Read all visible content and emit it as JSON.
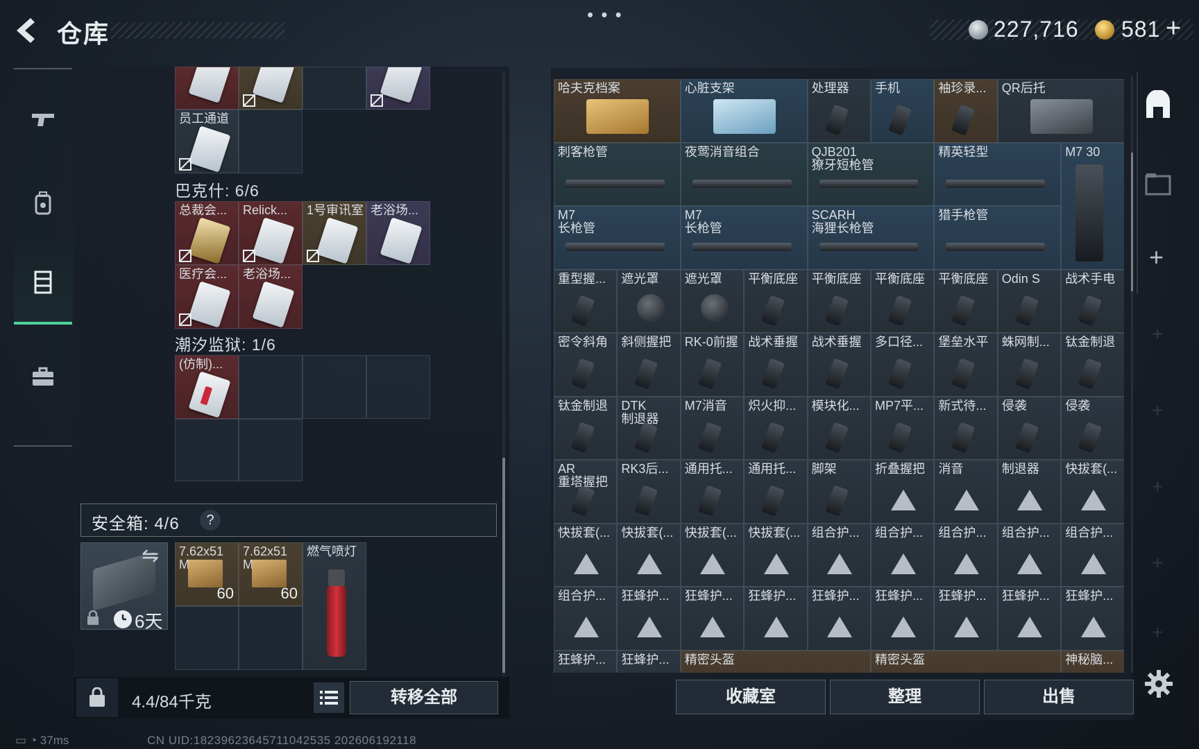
{
  "header": {
    "title": "仓库",
    "more_dots": "• • •",
    "currency_primary": "227,716",
    "currency_premium": "581",
    "currency_add": "+"
  },
  "left_nav": {
    "items": [
      {
        "name": "weapons",
        "icon": "pistol-icon"
      },
      {
        "name": "backpack",
        "icon": "backpack-icon"
      },
      {
        "name": "storage",
        "icon": "locker-icon",
        "active": true
      },
      {
        "name": "briefcase",
        "icon": "briefcase-icon"
      }
    ]
  },
  "left_storage": {
    "groups": [
      {
        "label": "巴克什: 6/6"
      },
      {
        "label": "潮汐监狱: 1/6"
      }
    ],
    "top_rows": [
      {
        "name": "",
        "color": "red"
      },
      {
        "name": "",
        "color": "gold"
      },
      {
        "name": "",
        "color": "empty"
      },
      {
        "name": "",
        "color": "purple"
      },
      {
        "name": "员工通道",
        "color": "grey"
      }
    ],
    "bakshi_items": [
      {
        "name": "总裁会...",
        "color": "red",
        "card": "gold"
      },
      {
        "name": "Relick...",
        "color": "red",
        "card": "white"
      },
      {
        "name": "1号审讯室",
        "color": "gold",
        "card": "white"
      },
      {
        "name": "老浴场...",
        "color": "purple",
        "card": "white"
      },
      {
        "name": "医疗会...",
        "color": "red",
        "card": "white"
      },
      {
        "name": "老浴场...",
        "color": "red",
        "card": "white"
      }
    ],
    "prison_items": [
      {
        "name": "(仿制)...",
        "color": "red",
        "card": "red"
      }
    ]
  },
  "safe_box": {
    "label": "安全箱:  4/6",
    "help": "?",
    "swap": "⇋",
    "days": "6天",
    "items": [
      {
        "name": "7.62x51\nM...",
        "qty": "60"
      },
      {
        "name": "7.62x51\nM...",
        "qty": "60"
      },
      {
        "name": "燃气喷灯",
        "qty": ""
      }
    ]
  },
  "left_bottom": {
    "weight": "4.4/84千克",
    "transfer_all": "转移全部"
  },
  "stash": {
    "rows": [
      [
        {
          "name": "哈夫克档案",
          "color": "tan",
          "w": 2
        },
        {
          "name": "心脏支架",
          "color": "blue",
          "w": 2
        },
        {
          "name": "处理器",
          "color": "grey",
          "w": 1
        },
        {
          "name": "手机",
          "color": "blue",
          "w": 1
        },
        {
          "name": "袖珍录...",
          "color": "tan",
          "w": 1
        },
        {
          "name": "QR后托",
          "color": "grey",
          "w": 2
        }
      ],
      [
        {
          "name": "刺客枪管",
          "color": "teal",
          "w": 2
        },
        {
          "name": "夜莺消音组合",
          "color": "teal",
          "w": 2
        },
        {
          "name": "QJB201\n獠牙短枪管",
          "color": "teal",
          "w": 2
        },
        {
          "name": "精英轻型",
          "color": "blue",
          "w": 2
        },
        {
          "name": "M7 30",
          "color": "blue",
          "w": 1
        }
      ],
      [
        {
          "name": "M7\n长枪管",
          "color": "blue",
          "w": 2
        },
        {
          "name": "M7\n长枪管",
          "color": "blue",
          "w": 2
        },
        {
          "name": "SCARH\n海狸长枪管",
          "color": "blue",
          "w": 2
        },
        {
          "name": "猎手枪管",
          "color": "blue",
          "w": 2
        }
      ],
      [
        {
          "name": "重型握...",
          "color": "grey",
          "w": 1
        },
        {
          "name": "遮光罩",
          "color": "grey",
          "w": 1
        },
        {
          "name": "遮光罩",
          "color": "grey",
          "w": 1
        },
        {
          "name": "平衡底座",
          "color": "grey",
          "w": 1
        },
        {
          "name": "平衡底座",
          "color": "grey",
          "w": 1
        },
        {
          "name": "平衡底座",
          "color": "grey",
          "w": 1
        },
        {
          "name": "平衡底座",
          "color": "grey",
          "w": 1
        },
        {
          "name": "Odin S",
          "color": "grey",
          "w": 1
        },
        {
          "name": "战术手电",
          "color": "grey",
          "w": 1
        }
      ],
      [
        {
          "name": "密令斜角",
          "color": "grey",
          "w": 1
        },
        {
          "name": "斜侧握把",
          "color": "grey",
          "w": 1
        },
        {
          "name": "RK-0前握",
          "color": "grey",
          "w": 1
        },
        {
          "name": "战术垂握",
          "color": "grey",
          "w": 1
        },
        {
          "name": "战术垂握",
          "color": "grey",
          "w": 1
        },
        {
          "name": "多口径...",
          "color": "grey",
          "w": 1
        },
        {
          "name": "堡垒水平",
          "color": "grey",
          "w": 1
        },
        {
          "name": "蛛网制...",
          "color": "grey",
          "w": 1
        },
        {
          "name": "钛金制退",
          "color": "grey",
          "w": 1
        }
      ],
      [
        {
          "name": "钛金制退",
          "color": "grey",
          "w": 1
        },
        {
          "name": "DTK\n制退器",
          "color": "grey",
          "w": 1
        },
        {
          "name": "M7消音",
          "color": "grey",
          "w": 1
        },
        {
          "name": "炽火抑...",
          "color": "grey",
          "w": 1
        },
        {
          "name": "模块化...",
          "color": "grey",
          "w": 1
        },
        {
          "name": "MP7平...",
          "color": "grey",
          "w": 1
        },
        {
          "name": "新式待...",
          "color": "grey",
          "w": 1
        },
        {
          "name": "侵袭",
          "color": "grey",
          "w": 1
        },
        {
          "name": "侵袭",
          "color": "grey",
          "w": 1
        }
      ],
      [
        {
          "name": "AR\n重塔握把",
          "color": "grey",
          "w": 1
        },
        {
          "name": "RK3后...",
          "color": "grey",
          "w": 1
        },
        {
          "name": "通用托...",
          "color": "grey",
          "w": 1
        },
        {
          "name": "通用托...",
          "color": "grey",
          "w": 1
        },
        {
          "name": "脚架",
          "color": "grey",
          "w": 1
        },
        {
          "name": "折叠握把",
          "color": "grey",
          "w": 1
        },
        {
          "name": "消音",
          "color": "grey",
          "w": 1
        },
        {
          "name": "制退器",
          "color": "grey",
          "w": 1
        },
        {
          "name": "快拔套(...",
          "color": "grey",
          "w": 1
        }
      ],
      [
        {
          "name": "快拔套(...",
          "color": "grey",
          "w": 1
        },
        {
          "name": "快拔套(...",
          "color": "grey",
          "w": 1
        },
        {
          "name": "快拔套(...",
          "color": "grey",
          "w": 1
        },
        {
          "name": "快拔套(...",
          "color": "grey",
          "w": 1
        },
        {
          "name": "组合护...",
          "color": "grey",
          "w": 1
        },
        {
          "name": "组合护...",
          "color": "grey",
          "w": 1
        },
        {
          "name": "组合护...",
          "color": "grey",
          "w": 1
        },
        {
          "name": "组合护...",
          "color": "grey",
          "w": 1
        },
        {
          "name": "组合护...",
          "color": "grey",
          "w": 1
        }
      ],
      [
        {
          "name": "组合护...",
          "color": "grey",
          "w": 1
        },
        {
          "name": "狂蜂护...",
          "color": "grey",
          "w": 1
        },
        {
          "name": "狂蜂护...",
          "color": "grey",
          "w": 1
        },
        {
          "name": "狂蜂护...",
          "color": "grey",
          "w": 1
        },
        {
          "name": "狂蜂护...",
          "color": "grey",
          "w": 1
        },
        {
          "name": "狂蜂护...",
          "color": "grey",
          "w": 1
        },
        {
          "name": "狂蜂护...",
          "color": "grey",
          "w": 1
        },
        {
          "name": "狂蜂护...",
          "color": "grey",
          "w": 1
        },
        {
          "name": "狂蜂护...",
          "color": "grey",
          "w": 1
        }
      ],
      [
        {
          "name": "狂蜂护...",
          "color": "grey",
          "w": 1
        },
        {
          "name": "狂蜂护...",
          "color": "grey",
          "w": 1
        },
        {
          "name": "精密头盔",
          "color": "tan",
          "w": 3
        },
        {
          "name": "精密头盔",
          "color": "tan",
          "w": 3
        },
        {
          "name": "神秘脑...",
          "color": "tan",
          "w": 1
        }
      ]
    ]
  },
  "bottom_buttons": {
    "collection": "收藏室",
    "sort": "整理",
    "sell": "出售"
  },
  "status_bar": {
    "ping": "37ms",
    "uid": "CN UID:18239623645711042535 202606192118"
  },
  "colors": {
    "accent_green": "#4fd29a",
    "red_rarity": "#5a2a2e",
    "gold_rarity": "#4a4030",
    "purple_rarity": "#3d3a55",
    "blue_rarity": "#2c4256"
  }
}
